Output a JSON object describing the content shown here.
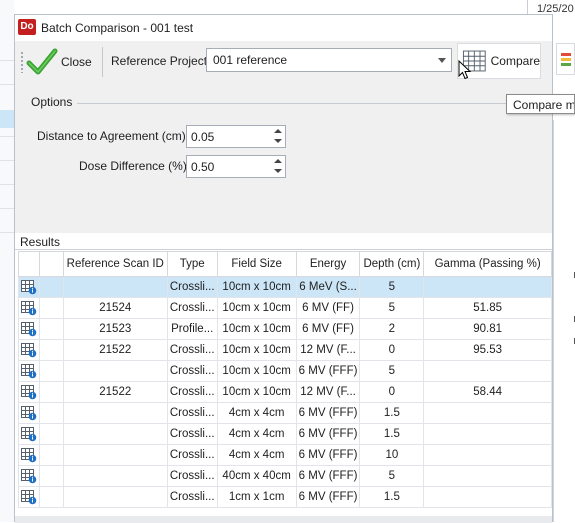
{
  "background": {
    "date_text": "1/25/20"
  },
  "window": {
    "app_icon_text": "Do",
    "title": "Batch Comparison - 001 test"
  },
  "toolbar": {
    "close_label": "Close",
    "reference_project_label": "Reference Project",
    "reference_project_value": "001 reference",
    "compare_label": "Compare",
    "compare_tooltip": "Compare m"
  },
  "options": {
    "header": "Options",
    "dta_label": "Distance to Agreement (cm)",
    "dta_value": "0.05",
    "dd_label": "Dose Difference (%)",
    "dd_value": "0.50"
  },
  "results": {
    "header": "Results",
    "columns": [
      "",
      "Reference Scan ID",
      "Type",
      "Field Size",
      "Energy",
      "Depth (cm)",
      "Gamma (Passing %)"
    ],
    "rows": [
      {
        "ref_id": "",
        "type": "Crossli...",
        "field": "10cm x 10cm",
        "energy": "6 MeV  (S...",
        "depth": "5",
        "gamma": "",
        "selected": true
      },
      {
        "ref_id": "21524",
        "type": "Crossli...",
        "field": "10cm x 10cm",
        "energy": "6 MV  (FF)",
        "depth": "5",
        "gamma": "51.85",
        "selected": false
      },
      {
        "ref_id": "21523",
        "type": "Profile...",
        "field": "10cm x 10cm",
        "energy": "6 MV  (FF)",
        "depth": "2",
        "gamma": "90.81",
        "selected": false
      },
      {
        "ref_id": "21522",
        "type": "Crossli...",
        "field": "10cm x 10cm",
        "energy": "12 MV  (F...",
        "depth": "0",
        "gamma": "95.53",
        "selected": false
      },
      {
        "ref_id": "",
        "type": "Crossli...",
        "field": "10cm x 10cm",
        "energy": "6 MV  (FFF)",
        "depth": "5",
        "gamma": "",
        "selected": false
      },
      {
        "ref_id": "21522",
        "type": "Crossli...",
        "field": "10cm x 10cm",
        "energy": "12 MV  (F...",
        "depth": "0",
        "gamma": "58.44",
        "selected": false
      },
      {
        "ref_id": "",
        "type": "Crossli...",
        "field": "4cm x 4cm",
        "energy": "6 MV  (FFF)",
        "depth": "1.5",
        "gamma": "",
        "selected": false
      },
      {
        "ref_id": "",
        "type": "Crossli...",
        "field": "4cm x 4cm",
        "energy": "6 MV  (FFF)",
        "depth": "1.5",
        "gamma": "",
        "selected": false
      },
      {
        "ref_id": "",
        "type": "Crossli...",
        "field": "4cm x 4cm",
        "energy": "6 MV  (FFF)",
        "depth": "10",
        "gamma": "",
        "selected": false
      },
      {
        "ref_id": "",
        "type": "Crossli...",
        "field": "40cm x 40cm",
        "energy": "6 MV  (FFF)",
        "depth": "5",
        "gamma": "",
        "selected": false
      },
      {
        "ref_id": "",
        "type": "Crossli...",
        "field": "1cm x 1cm",
        "energy": "6 MV  (FFF)",
        "depth": "1.5",
        "gamma": "",
        "selected": false
      }
    ]
  },
  "colors": {
    "selection": "#cde6f7",
    "check_green": "#3aa335",
    "app_icon_red": "#c41f1f"
  },
  "icons": {
    "close": "green-check-icon",
    "compare": "grid-compare-icon",
    "row": "scan-info-icon"
  }
}
